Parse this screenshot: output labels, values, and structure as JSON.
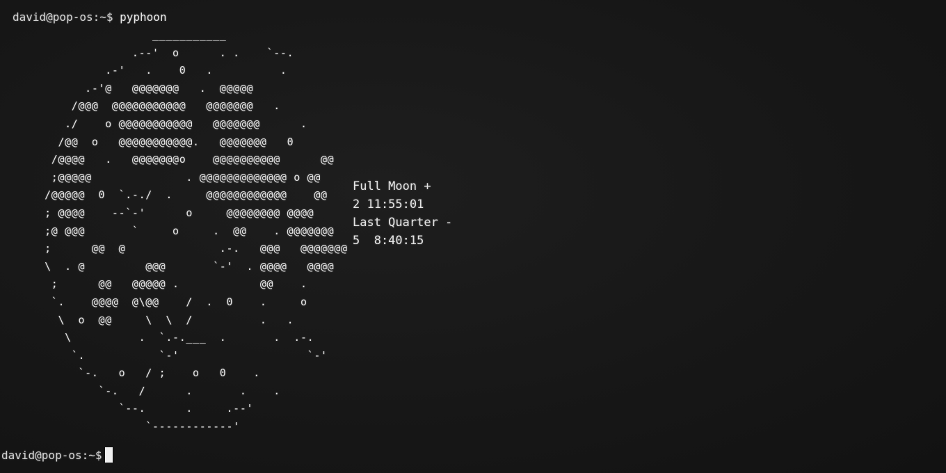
{
  "terminal": {
    "prompt": "david@pop-os:~$",
    "command": "pyphoon",
    "moon_art": "                      ___________\n                   .--'  o      . .    `--.\n               .-'   .    0   .          .\n            .-'@   @@@@@@@   .  @@@@@\n          /@@@  @@@@@@@@@@@   @@@@@@@   .\n         ./    o @@@@@@@@@@@   @@@@@@@      .\n        /@@  o   @@@@@@@@@@@.   @@@@@@@   0\n       /@@@@   .   @@@@@@@o    @@@@@@@@@@      @@\n       ;@@@@@              . @@@@@@@@@@@@@ o @@\n      /@@@@@  0  `.-./  .     @@@@@@@@@@@@    @@\n      ; @@@@    --`-'      o     @@@@@@@@ @@@@\n      ;@ @@@       `     o     .  @@    . @@@@@@@\n      ;      @@  @              .-.   @@@   @@@@@@@\n      \\  . @         @@@       `-'  . @@@@   @@@@\n       ;      @@   @@@@@ .            @@    .\n       `.    @@@@  @\\@@    /  .  0    .     o\n        \\  o  @@     \\  \\  /          .   .\n         \\          .  `.-.___  .       .  .-.\n          `.           `-'                   `-'\n           `-.   o   / ;    o   0    .\n              `-.   /      .       .    .\n                 `--.      .     .--'\n                     `------------'",
    "phase_info": [
      "Full Moon +",
      "2 11:55:01",
      "Last Quarter -",
      "5  8:40:15"
    ]
  },
  "colors": {
    "background": "#161616",
    "text": "#e4e4e4",
    "cursor": "#f0f0f0"
  }
}
